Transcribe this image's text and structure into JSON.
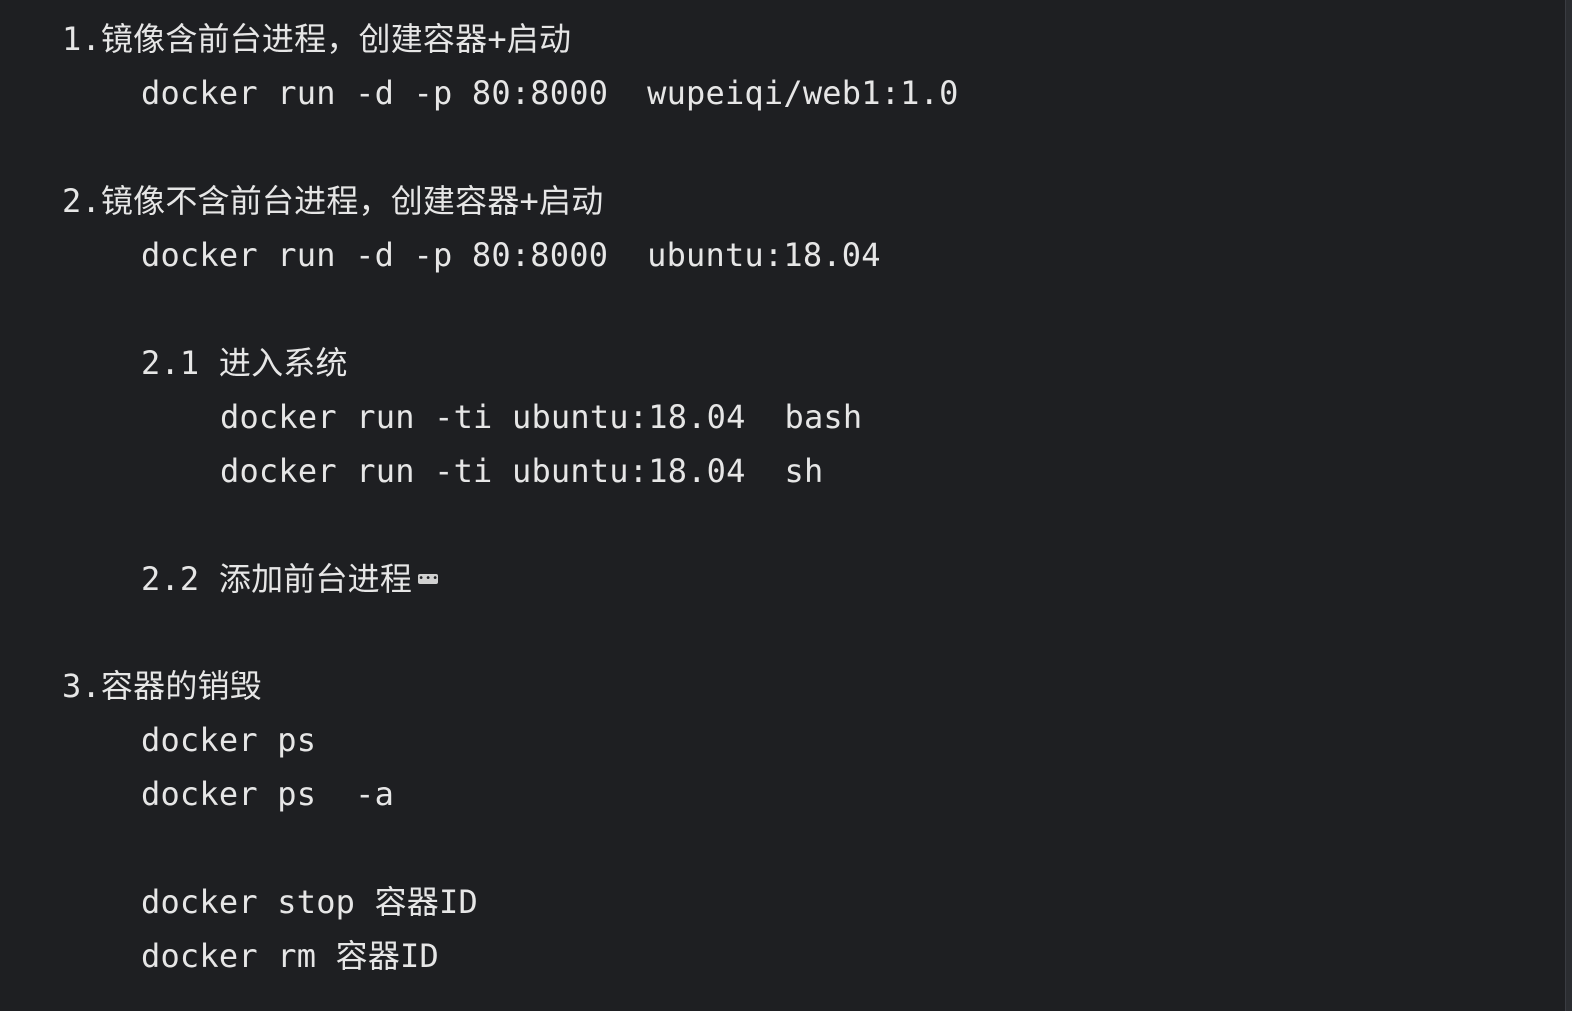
{
  "lines": [
    {
      "text": "1.镜像含前台进程，创建容器+启动"
    },
    {
      "text": "docker run -d -p 80:8000  wupeiqi/web1:1.0"
    },
    {
      "text": "2.镜像不含前台进程，创建容器+启动"
    },
    {
      "text": "docker run -d -p 80:8000  ubuntu:18.04"
    },
    {
      "text": "2.1 进入系统"
    },
    {
      "text": "docker run -ti ubuntu:18.04  bash"
    },
    {
      "text": "docker run -ti ubuntu:18.04  sh"
    },
    {
      "text": "2.2 添加前台进程",
      "fold_glyph": "•••"
    },
    {
      "text": "3.容器的销毁"
    },
    {
      "text": "docker ps"
    },
    {
      "text": "docker ps  -a"
    },
    {
      "text": "docker stop 容器ID"
    },
    {
      "text": "docker rm 容器ID"
    }
  ],
  "colors": {
    "background": "#1e1f22",
    "text": "#e6e6e6"
  }
}
